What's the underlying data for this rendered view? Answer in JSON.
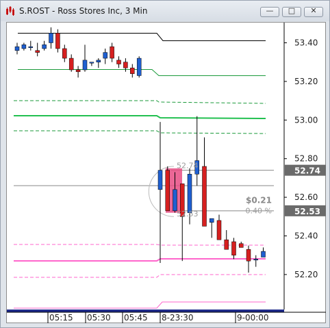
{
  "window": {
    "title": "S.ROST - Ross Stores Inc, 3 Min",
    "buttons": {
      "minimize": "—",
      "maximize": "□",
      "close": "✕"
    }
  },
  "chart_data": {
    "type": "candlestick",
    "symbol": "S.ROST",
    "company": "Ross Stores Inc",
    "interval": "3 Min",
    "y_ticks": [
      "53.40",
      "53.20",
      "53.00",
      "52.80",
      "52.60",
      "52.40",
      "52.20"
    ],
    "y_tick_values": [
      53.4,
      53.2,
      53.0,
      52.8,
      52.6,
      52.4,
      52.2
    ],
    "x_ticks": [
      "05:15",
      "05:30",
      "05:45",
      "8-23:30",
      "9-00:00"
    ],
    "price_labels": [
      {
        "text": "52.74",
        "value": 52.74
      },
      {
        "text": "52.53",
        "value": 52.53
      }
    ],
    "annotations": {
      "change": "$0.21",
      "change_pct": "0.40 %",
      "faded_upper": "52.74",
      "faded_lower": "52.53"
    },
    "candles": [
      {
        "o": 53.36,
        "h": 53.4,
        "l": 53.34,
        "c": 53.38
      },
      {
        "o": 53.37,
        "h": 53.4,
        "l": 53.36,
        "c": 53.39
      },
      {
        "o": 53.38,
        "h": 53.41,
        "l": 53.36,
        "c": 53.38
      },
      {
        "o": 53.36,
        "h": 53.4,
        "l": 53.33,
        "c": 53.35
      },
      {
        "o": 53.37,
        "h": 53.41,
        "l": 53.36,
        "c": 53.39
      },
      {
        "o": 53.4,
        "h": 53.48,
        "l": 53.37,
        "c": 53.45
      },
      {
        "o": 53.45,
        "h": 53.47,
        "l": 53.35,
        "c": 53.37
      },
      {
        "o": 53.37,
        "h": 53.39,
        "l": 53.3,
        "c": 53.32
      },
      {
        "o": 53.32,
        "h": 53.34,
        "l": 53.25,
        "c": 53.26
      },
      {
        "o": 53.26,
        "h": 53.28,
        "l": 53.22,
        "c": 53.25
      },
      {
        "o": 53.26,
        "h": 53.39,
        "l": 53.25,
        "c": 53.31
      },
      {
        "o": 53.3,
        "h": 53.3,
        "l": 53.28,
        "c": 53.3
      },
      {
        "o": 53.3,
        "h": 53.32,
        "l": 53.27,
        "c": 53.31
      },
      {
        "o": 53.32,
        "h": 53.37,
        "l": 53.29,
        "c": 53.35
      },
      {
        "o": 53.38,
        "h": 53.4,
        "l": 53.3,
        "c": 53.32
      },
      {
        "o": 53.31,
        "h": 53.33,
        "l": 53.27,
        "c": 53.29
      },
      {
        "o": 53.3,
        "h": 53.32,
        "l": 53.25,
        "c": 53.27
      },
      {
        "o": 53.27,
        "h": 53.29,
        "l": 53.22,
        "c": 53.24
      },
      {
        "o": 53.23,
        "h": 53.33,
        "l": 53.22,
        "c": 53.32
      },
      {
        "o": 52.64,
        "h": 52.99,
        "l": 52.26,
        "c": 52.74
      },
      {
        "o": 52.74,
        "h": 52.76,
        "l": 52.53,
        "c": 52.53
      },
      {
        "o": 52.53,
        "h": 52.73,
        "l": 52.52,
        "c": 52.64
      },
      {
        "o": 52.67,
        "h": 52.67,
        "l": 52.27,
        "c": 52.5
      },
      {
        "o": 52.52,
        "h": 52.75,
        "l": 52.46,
        "c": 52.72
      },
      {
        "o": 52.72,
        "h": 53.02,
        "l": 52.66,
        "c": 52.79
      },
      {
        "o": 52.76,
        "h": 52.91,
        "l": 52.45,
        "c": 52.45
      },
      {
        "o": 52.47,
        "h": 52.49,
        "l": 52.39,
        "c": 52.49
      },
      {
        "o": 52.48,
        "h": 52.51,
        "l": 52.38,
        "c": 52.38
      },
      {
        "o": 52.38,
        "h": 52.43,
        "l": 52.33,
        "c": 52.33
      },
      {
        "o": 52.37,
        "h": 52.39,
        "l": 52.28,
        "c": 52.3
      },
      {
        "o": 52.36,
        "h": 52.37,
        "l": 52.34,
        "c": 52.34
      },
      {
        "o": 52.33,
        "h": 52.35,
        "l": 52.21,
        "c": 52.27
      },
      {
        "o": 52.28,
        "h": 52.3,
        "l": 52.24,
        "c": 52.28
      },
      {
        "o": 52.29,
        "h": 52.34,
        "l": 52.29,
        "c": 52.32
      }
    ],
    "colors": {
      "up": "#1f5fd0",
      "down": "#d62020",
      "level_black": "#000000",
      "level_green": "#1a9a3a",
      "level_green_bright": "#22c050",
      "level_pink": "#ff66cc",
      "level_gray": "#888888",
      "label_bg": "#6a6a6a",
      "highlight": "#e84c84"
    }
  }
}
